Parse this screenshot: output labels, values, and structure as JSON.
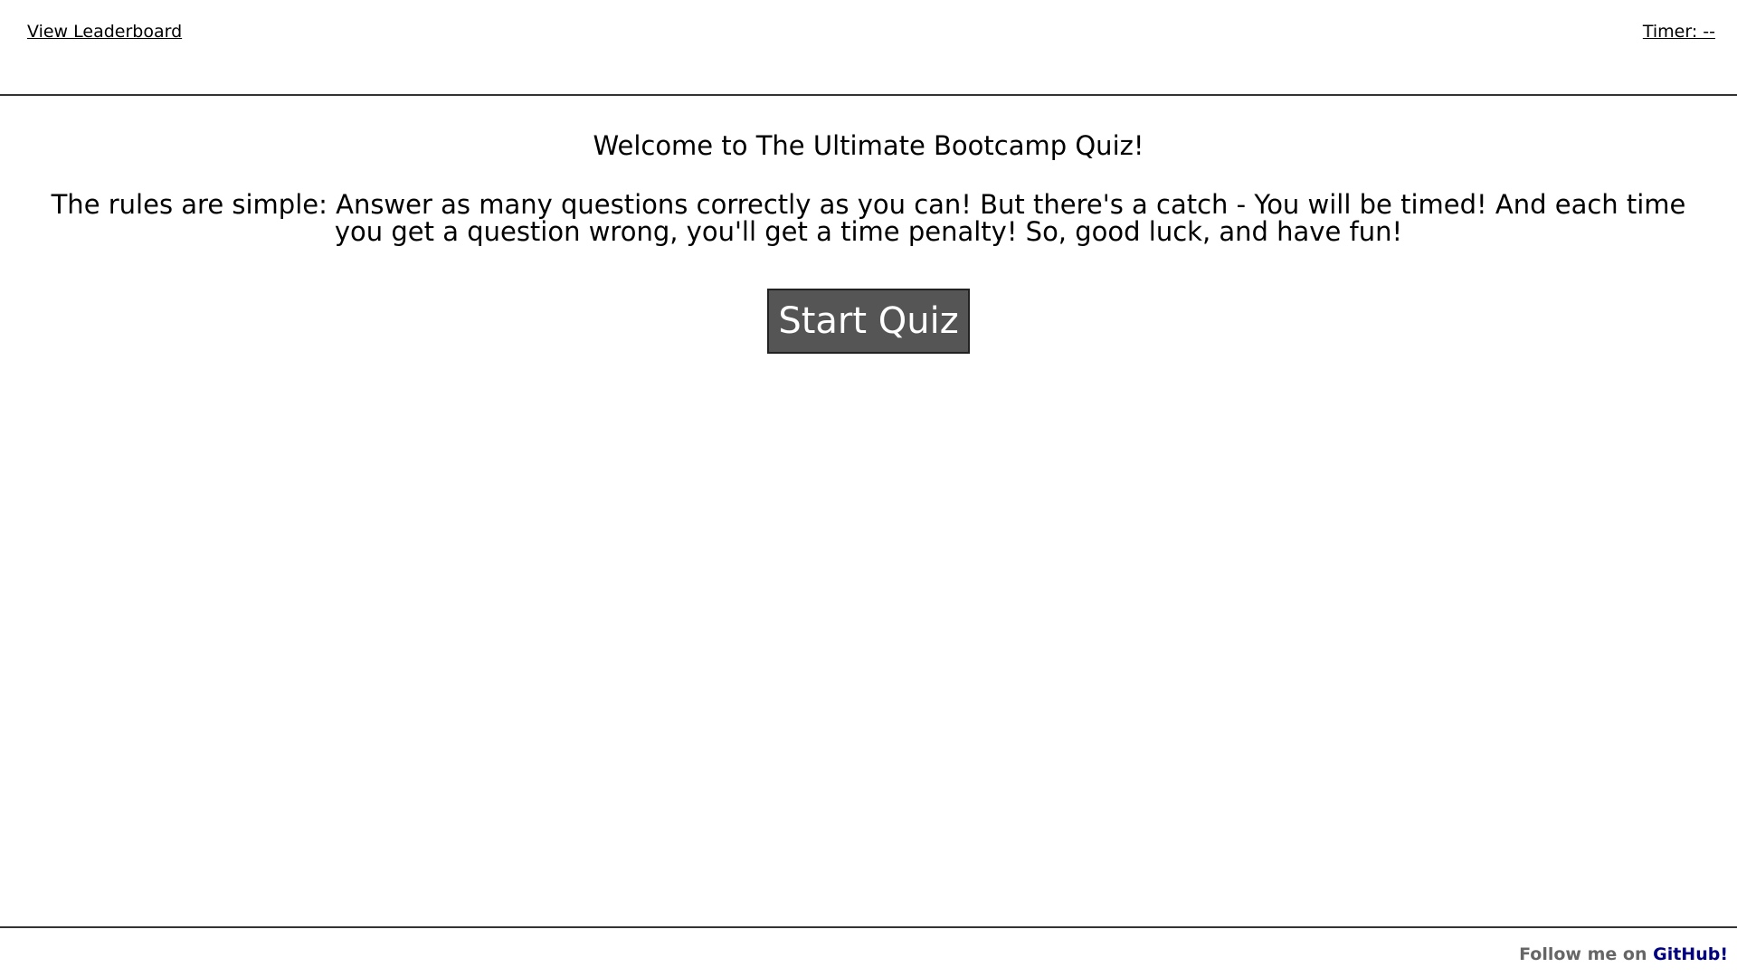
{
  "header": {
    "leaderboard_link": "View Leaderboard",
    "timer": "Timer: --"
  },
  "main": {
    "welcome": "Welcome to The Ultimate Bootcamp Quiz!",
    "rules": "The rules are simple: Answer as many questions correctly as you can! But there's a catch - You will be timed! And each time you get a question wrong, you'll get a time penalty! So, good luck, and have fun!",
    "start_button": "Start Quiz"
  },
  "footer": {
    "text": "Follow me on",
    "link": "GitHub!"
  },
  "colors": {
    "button_bg": "#555555",
    "link_color": "#000080",
    "footer_text": "#666666"
  }
}
